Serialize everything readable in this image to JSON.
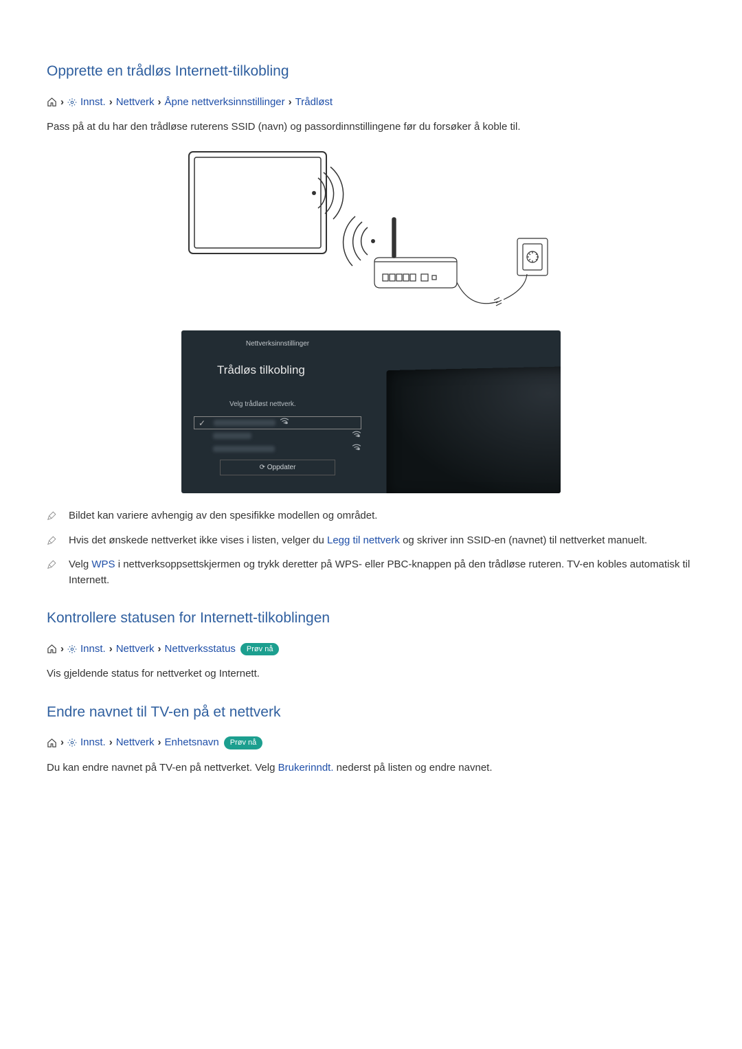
{
  "section1": {
    "heading": "Opprette en trådløs Internett-tilkobling",
    "breadcrumb": {
      "innst": "Innst.",
      "nettverk": "Nettverk",
      "open": "Åpne nettverksinnstillinger",
      "wireless": "Trådløst"
    },
    "intro": "Pass på at du har den trådløse ruterens SSID (navn) og passordinnstillingene før du forsøker å koble til."
  },
  "screen": {
    "title": "Nettverksinnstillinger",
    "sub": "Trådløs tilkobling",
    "pick": "Velg trådløst nettverk.",
    "refresh": "Oppdater"
  },
  "notes": {
    "n1": "Bildet kan variere avhengig av den spesifikke modellen og området.",
    "n2a": "Hvis det ønskede nettverket ikke vises i listen, velger du ",
    "n2link": "Legg til nettverk",
    "n2b": " og skriver inn SSID-en (navnet) til nettverket manuelt.",
    "n3a": "Velg ",
    "n3link": "WPS",
    "n3b": " i nettverksoppsettskjermen og trykk deretter på WPS- eller PBC-knappen på den trådløse ruteren. TV-en kobles automatisk til Internett."
  },
  "section2": {
    "heading": "Kontrollere statusen for Internett-tilkoblingen",
    "breadcrumb": {
      "innst": "Innst.",
      "nettverk": "Nettverk",
      "status": "Nettverksstatus",
      "try": "Prøv nå"
    },
    "body": "Vis gjeldende status for nettverket og Internett."
  },
  "section3": {
    "heading": "Endre navnet til TV-en på et nettverk",
    "breadcrumb": {
      "innst": "Innst.",
      "nettverk": "Nettverk",
      "devname": "Enhetsnavn",
      "try": "Prøv nå"
    },
    "body_a": "Du kan endre navnet på TV-en på nettverket. Velg ",
    "body_link": "Brukerinndt.",
    "body_b": " nederst på listen og endre navnet."
  }
}
